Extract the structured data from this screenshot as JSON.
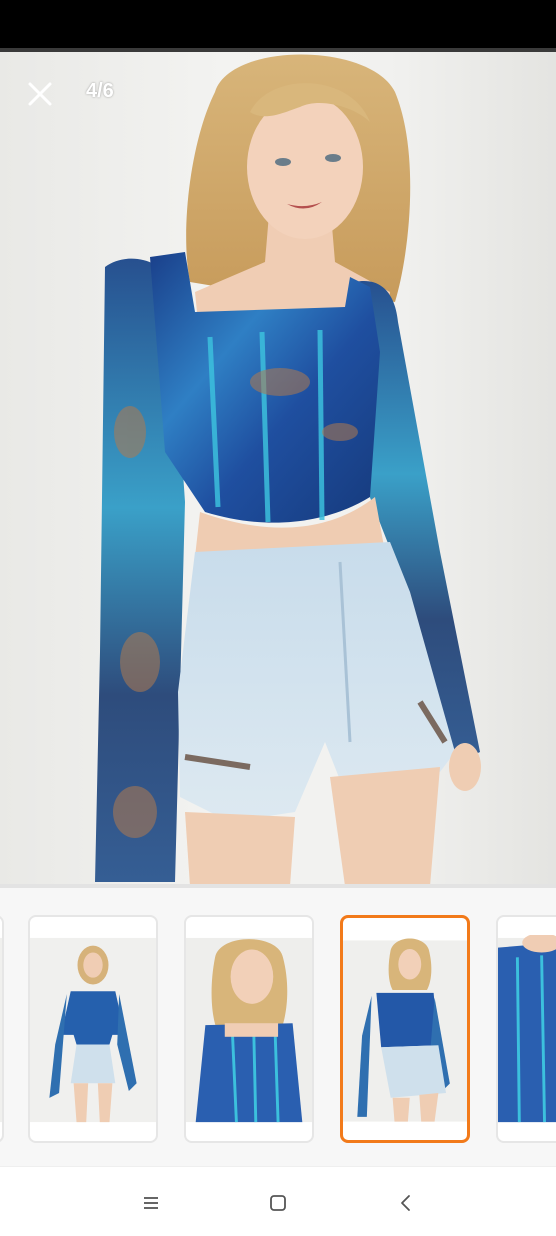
{
  "viewer": {
    "counter": "4/6",
    "close_icon": "close-icon"
  },
  "colors": {
    "selected_border": "#f27a1a",
    "top_primary": "#1f57a8",
    "top_accent": "#3bb3d8",
    "shorts": "#cfe0ec"
  },
  "thumbnails": [
    {
      "icon": "product-photo",
      "selected": false
    },
    {
      "icon": "product-photo",
      "selected": false
    },
    {
      "icon": "product-photo",
      "selected": false
    },
    {
      "icon": "product-photo",
      "selected": true
    },
    {
      "icon": "product-photo",
      "selected": false
    }
  ],
  "nav": {
    "recents_icon": "menu-icon",
    "home_icon": "home-square-icon",
    "back_icon": "back-chevron-icon"
  }
}
